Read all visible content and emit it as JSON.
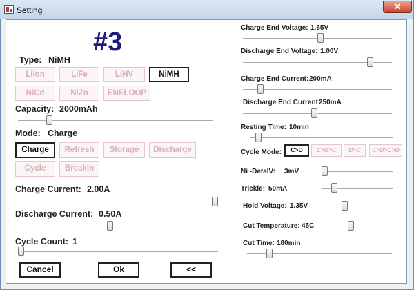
{
  "window": {
    "title": "Setting",
    "close_glyph": "✕"
  },
  "channel": "#3",
  "left": {
    "type_label": "Type:",
    "type_value": "NiMH",
    "types": [
      "LiIon",
      "LiFe",
      "LiHV",
      "NiMH",
      "NiCd",
      "NiZn",
      "ENELOOP"
    ],
    "selected_type": "NiMH",
    "capacity_label": "Capacity:",
    "capacity_value": "2000mAh",
    "capacity_level": 0.15,
    "mode_label": "Mode:",
    "mode_value": "Charge",
    "modes": [
      "Charge",
      "Refresh",
      "Storage",
      "Discharge",
      "Cycle",
      "BreakIn"
    ],
    "selected_mode": "Charge",
    "charge_current_label": "Charge Current:",
    "charge_current_value": "2.00A",
    "charge_current_level": 1.0,
    "discharge_current_label": "Discharge Current:",
    "discharge_current_value": "0.50A",
    "discharge_current_level": 0.46,
    "cycle_count_label": "Cycle Count:",
    "cycle_count_value": "1",
    "cycle_count_level": 0.0
  },
  "right": {
    "charge_end_voltage_label": "Charge End Voltage:",
    "charge_end_voltage_value": "1.65V",
    "charge_end_voltage_level": 0.52,
    "discharge_end_voltage_label": "Discharge End Voltage:",
    "discharge_end_voltage_value": "1.00V",
    "discharge_end_voltage_level": 0.87,
    "charge_end_current_label": "Charge End Current:",
    "charge_end_current_value": "200mA",
    "charge_end_current_level": 0.1,
    "discharge_end_current_label": "Discharge End Current:",
    "discharge_end_current_value": "250mA",
    "discharge_end_current_level": 0.48,
    "resting_time_label": "Resting Time:",
    "resting_time_value": "10min",
    "resting_time_level": 0.04,
    "cycle_mode_label": "Cycle Mode:",
    "cycle_modes": [
      "C>D",
      "C>D>C",
      "D>C",
      "C>D>C>D"
    ],
    "selected_cycle_mode": "C>D",
    "ni_delta_label": "Ni -DetalV:",
    "ni_delta_value": "3mV",
    "ni_delta_level": 0.0,
    "trickle_label": "Trickle:",
    "trickle_value": "50mA",
    "trickle_level": 0.15,
    "hold_voltage_label": "Hold Voltage:",
    "hold_voltage_value": "1.35V",
    "hold_voltage_level": 0.3,
    "cut_temp_label": "Cut Temperature:",
    "cut_temp_value": "45C",
    "cut_temp_level": 0.4,
    "cut_time_label": "Cut Time:",
    "cut_time_value": "180min",
    "cut_time_level": 0.14
  },
  "actions": {
    "cancel": "Cancel",
    "ok": "Ok",
    "collapse": "<<"
  }
}
